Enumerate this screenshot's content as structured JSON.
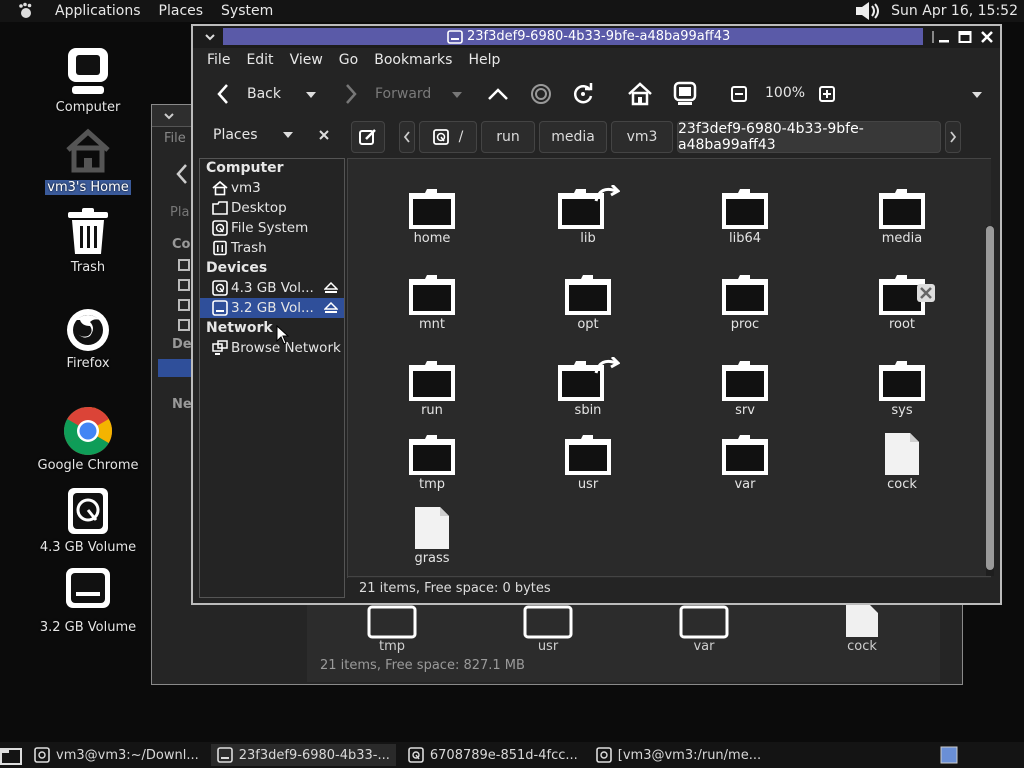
{
  "top_panel": {
    "menus": [
      "Applications",
      "Places",
      "System"
    ],
    "clock": "Sun Apr 16, 15:52",
    "icons": [
      "gnome-foot-icon",
      "volume-icon"
    ]
  },
  "desktop": {
    "icons": [
      {
        "label": "Computer",
        "icon": "computer-icon",
        "selected": false
      },
      {
        "label": "vm3's Home",
        "icon": "home-icon",
        "selected": true
      },
      {
        "label": "Trash",
        "icon": "trash-icon",
        "selected": false
      },
      {
        "label": "Firefox",
        "icon": "firefox-icon",
        "selected": false
      },
      {
        "label": "Google Chrome",
        "icon": "chrome-icon",
        "selected": false
      },
      {
        "label": "4.3 GB Volume",
        "icon": "drive-icon",
        "selected": false
      },
      {
        "label": "3.2 GB Volume",
        "icon": "drive-icon",
        "selected": false
      }
    ]
  },
  "back_window": {
    "menu_fragment": "File",
    "sidebar_fragments": [
      "Pla",
      "Co",
      "Dev",
      "Net"
    ],
    "items": [
      "tmp",
      "usr",
      "var",
      "cock"
    ],
    "status": "21 items, Free space: 827.1 MB"
  },
  "window": {
    "title": "23f3def9-6980-4b33-9bfe-a48ba99aff43",
    "menu": [
      "File",
      "Edit",
      "View",
      "Go",
      "Bookmarks",
      "Help"
    ],
    "toolbar": {
      "back": "Back",
      "forward": "Forward",
      "zoom": "100%"
    },
    "places_label": "Places",
    "breadcrumbs": [
      "/",
      "run",
      "media",
      "vm3",
      "23f3def9-6980-4b33-9bfe-a48ba99aff43"
    ],
    "sidebar": {
      "computer_head": "Computer",
      "computer_items": [
        "vm3",
        "Desktop",
        "File System",
        "Trash"
      ],
      "devices_head": "Devices",
      "devices_items": [
        "4.3 GB Vol...",
        "3.2 GB Vol..."
      ],
      "network_head": "Network",
      "network_items": [
        "Browse Network"
      ]
    },
    "files": [
      {
        "name": "home",
        "type": "folder"
      },
      {
        "name": "lib",
        "type": "folder-link"
      },
      {
        "name": "lib64",
        "type": "folder"
      },
      {
        "name": "media",
        "type": "folder"
      },
      {
        "name": "mnt",
        "type": "folder"
      },
      {
        "name": "opt",
        "type": "folder"
      },
      {
        "name": "proc",
        "type": "folder"
      },
      {
        "name": "root",
        "type": "folder-locked"
      },
      {
        "name": "run",
        "type": "folder"
      },
      {
        "name": "sbin",
        "type": "folder-link"
      },
      {
        "name": "srv",
        "type": "folder"
      },
      {
        "name": "sys",
        "type": "folder"
      },
      {
        "name": "tmp",
        "type": "folder"
      },
      {
        "name": "usr",
        "type": "folder"
      },
      {
        "name": "var",
        "type": "folder"
      },
      {
        "name": "cock",
        "type": "file"
      },
      {
        "name": "grass",
        "type": "file"
      }
    ],
    "status": "21 items, Free space: 0 bytes"
  },
  "taskbar": {
    "tasks": [
      {
        "label": "vm3@vm3:~/Downl...",
        "icon": "terminal-icon",
        "active": false
      },
      {
        "label": "23f3def9-6980-4b33-...",
        "icon": "drive-icon",
        "active": true
      },
      {
        "label": "6708789e-851d-4fcc...",
        "icon": "drive-icon",
        "active": false
      },
      {
        "label": "[vm3@vm3:/run/me...",
        "icon": "terminal-icon",
        "active": false
      }
    ]
  }
}
